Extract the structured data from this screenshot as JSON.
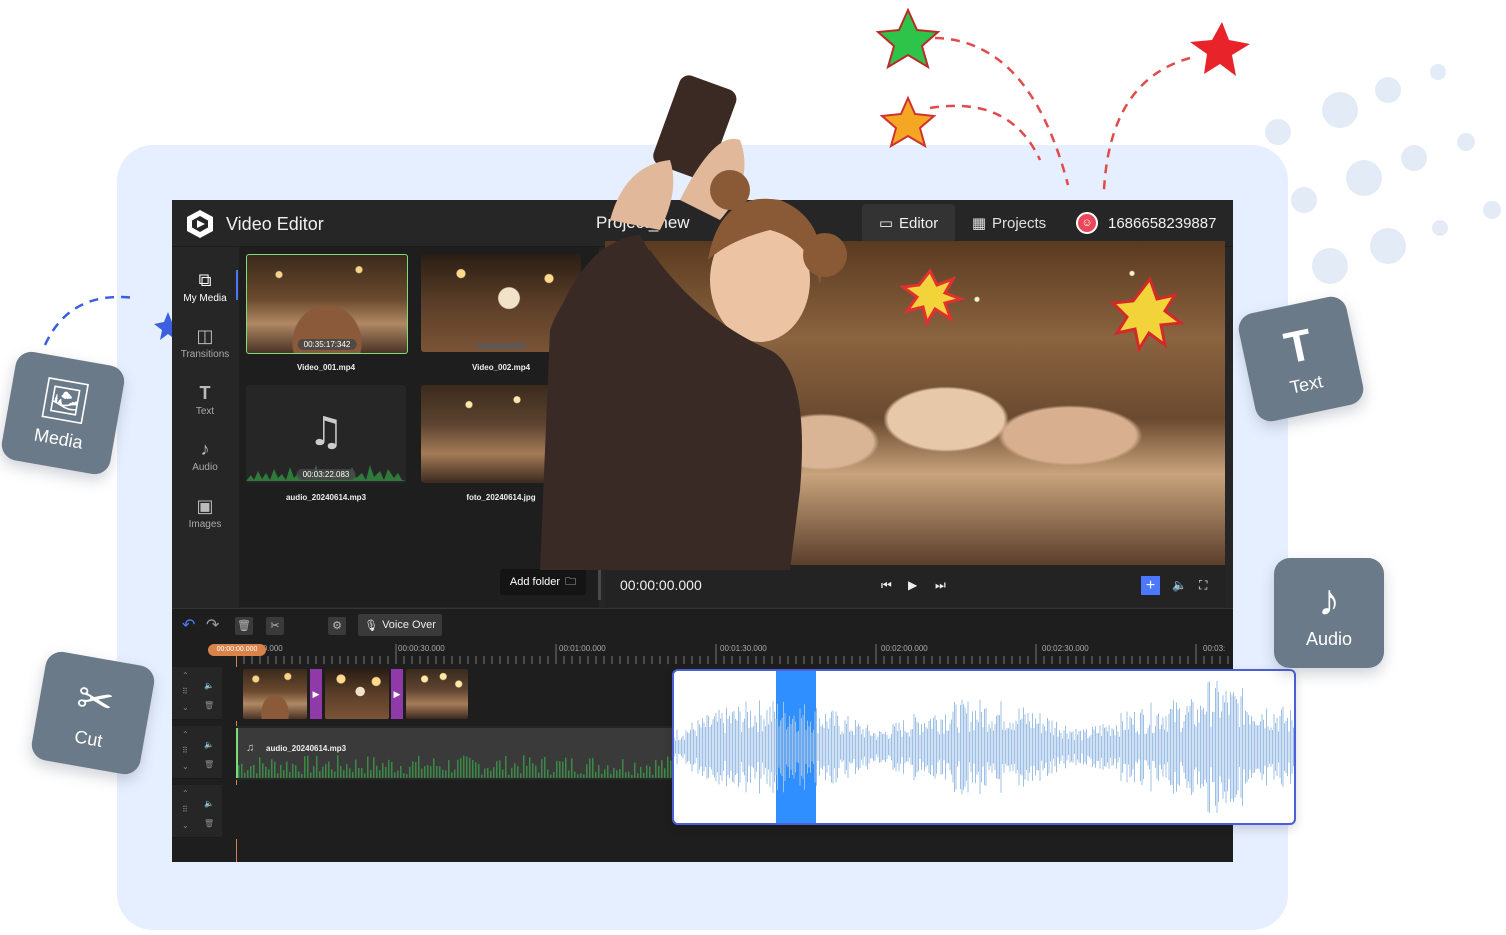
{
  "app": {
    "title": "Video Editor",
    "project_name": "Project_new",
    "tabs": [
      {
        "label": "Editor",
        "active": true
      },
      {
        "label": "Projects",
        "active": false
      }
    ],
    "user_id": "1686658239887"
  },
  "sidebar": {
    "items": [
      {
        "label": "My Media",
        "icon": "media-library-icon",
        "active": true
      },
      {
        "label": "Transitions",
        "icon": "transitions-icon"
      },
      {
        "label": "Text",
        "icon": "text-icon"
      },
      {
        "label": "Audio",
        "icon": "music-note-icon"
      },
      {
        "label": "Images",
        "icon": "image-icon"
      }
    ]
  },
  "media": {
    "items": [
      {
        "name": "Video_001.mp4",
        "duration": "00:35:17:342"
      },
      {
        "name": "Video_002.mp4",
        "duration": ""
      },
      {
        "name": "audio_20240614.mp3",
        "duration": "00:03:22.083"
      },
      {
        "name": "foto_20240614.jpg",
        "duration": ""
      }
    ],
    "add_folder_label": "Add folder"
  },
  "preview": {
    "timecode": "00:00:00.000"
  },
  "timeline": {
    "voice_over_label": "Voice Over",
    "playhead_time": "00:00:00.000",
    "ruler_labels": [
      "00:00:00.000",
      "00:00:30.000",
      "00:01:00.000",
      "00:01:30.000",
      "00:02:00.000",
      "00:02:30.000",
      "00:03:"
    ],
    "audio_clip_label": "audio_20240614.mp3"
  },
  "feature_tiles": [
    {
      "label": "Media",
      "icon": "image-icon"
    },
    {
      "label": "Text",
      "icon": "text-icon"
    },
    {
      "label": "Audio",
      "icon": "music-note-icon"
    },
    {
      "label": "Cut",
      "icon": "scissors-icon"
    }
  ],
  "colors": {
    "accent": "#4a79ff",
    "playhead": "#d9834a",
    "transition": "#8f3aa8",
    "wave_selection": "#2f8fff",
    "background_card": "#e6efff"
  }
}
